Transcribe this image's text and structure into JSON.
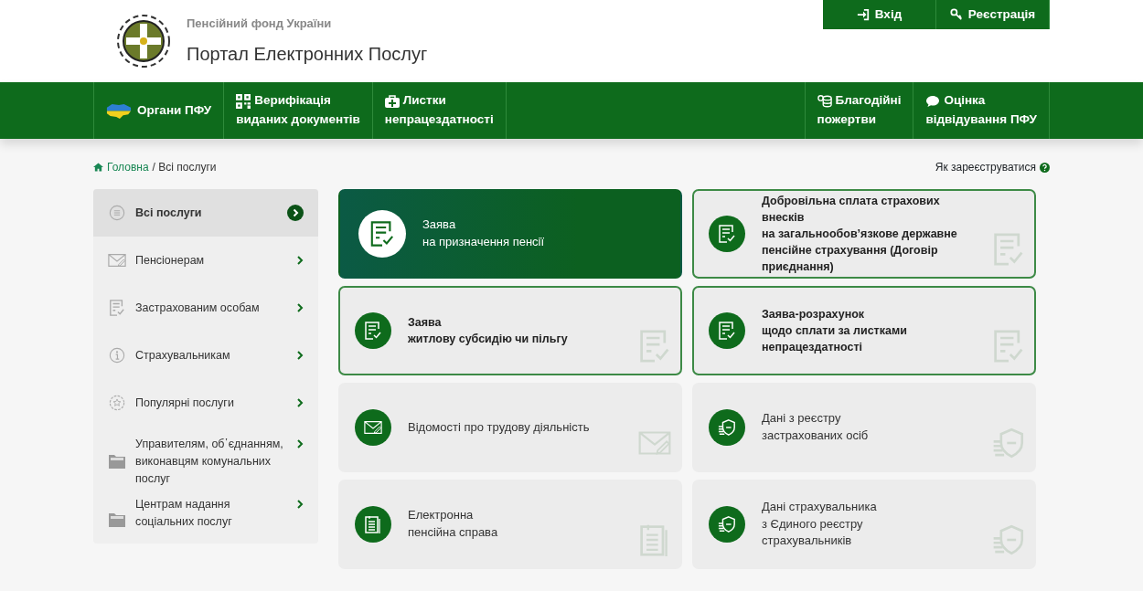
{
  "header": {
    "org": "Пенсійний фонд України",
    "title": "Портал Електронних Послуг"
  },
  "auth_buttons": [
    {
      "label": "Вхід"
    },
    {
      "label": "Реєстрація"
    }
  ],
  "nav_left": [
    {
      "lines": [
        "Органи ПФУ"
      ]
    },
    {
      "lines": [
        "Верифікація",
        "виданих документів"
      ]
    },
    {
      "lines": [
        "Листки",
        "непрацездатності"
      ]
    }
  ],
  "nav_right": [
    {
      "lines": [
        "Благодійні",
        "пожертви"
      ]
    },
    {
      "lines": [
        "Оцінка",
        "відвідування ПФУ"
      ]
    }
  ],
  "breadcrumb": {
    "home": "Головна",
    "current": "/ Всі послуги"
  },
  "help_link": "Як зареєструватися",
  "sidebar": [
    {
      "label": "Всі послуги",
      "selected": true
    },
    {
      "label": "Пенсіонерам",
      "selected": false
    },
    {
      "label": "Застрахованим особам",
      "selected": false
    },
    {
      "label": "Страхувальникам",
      "selected": false
    },
    {
      "label": "Популярні послуги",
      "selected": false
    },
    {
      "label": "Управителям, об῾єднанням, виконавцям комунальних послуг",
      "selected": false
    },
    {
      "label": "Центрам надання соціальних послуг",
      "selected": false
    }
  ],
  "services": [
    {
      "kind": "featured",
      "lines": [
        "Заява",
        "на призначення пенсії"
      ]
    },
    {
      "kind": "outlined",
      "lines": [
        "Добровільна сплата страхових внесків",
        "на загальнообов’язкове державне",
        "пенсійне страхування (Договір",
        "приєднання)"
      ]
    },
    {
      "kind": "outlined",
      "lines": [
        "Заява",
        "житлову субсидію чи пільгу"
      ]
    },
    {
      "kind": "outlined",
      "lines": [
        "Заява-розрахунок",
        "щодо сплати за листками",
        "непрацездатності"
      ]
    },
    {
      "kind": "plain",
      "lines": [
        "Відомості про трудову діяльність"
      ]
    },
    {
      "kind": "plain",
      "lines": [
        "Дані з реєстру",
        "застрахованих осіб"
      ]
    },
    {
      "kind": "plain",
      "lines": [
        "Електронна",
        "пенсійна справа"
      ]
    },
    {
      "kind": "plain",
      "lines": [
        "Дані страхувальника",
        "з Єдиного реєстру",
        "страхувальників"
      ]
    }
  ]
}
